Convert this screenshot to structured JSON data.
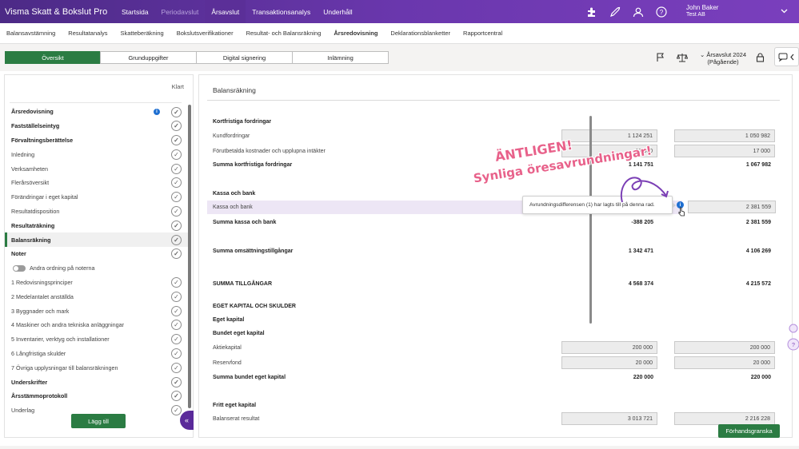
{
  "app": {
    "title": "Visma Skatt & Bokslut Pro",
    "top_nav": [
      "Startsida",
      "Periodavslut",
      "Årsavslut",
      "Transaktionsanalys",
      "Underhåll"
    ],
    "user_name": "John Baker",
    "user_company": "Test AB",
    "colors": {
      "brand": "#5b2f98",
      "accent": "#2b7c43",
      "info": "#1f6fd1",
      "promo": "#e8618a"
    }
  },
  "sub_nav": [
    "Balansavstämning",
    "Resultatanalys",
    "Skatteberäkning",
    "Bokslutsverifikationer",
    "Resultat- och Balansräkning",
    "Årsredovisning",
    "Deklarationsblanketter",
    "Rapportcentral"
  ],
  "tabs": [
    "Översikt",
    "Grunduppgifter",
    "Digital signering",
    "Inlämning"
  ],
  "year": {
    "line1": "Årsavslut 2024",
    "line2": "(Pågående)"
  },
  "left": {
    "klart": "Klart",
    "items": [
      {
        "label": "Årsredovisning",
        "bold": true,
        "check": true,
        "info": true
      },
      {
        "label": "Fastställelseintyg",
        "bold": true,
        "check": true
      },
      {
        "label": "Förvaltningsberättelse",
        "bold": true,
        "check": true
      },
      {
        "label": "Inledning",
        "bold": false,
        "check": true
      },
      {
        "label": "Verksamheten",
        "bold": false,
        "check": true
      },
      {
        "label": "Flerårsöversikt",
        "bold": false,
        "check": true
      },
      {
        "label": "Förändringar i eget kapital",
        "bold": false,
        "check": true
      },
      {
        "label": "Resultatdisposition",
        "bold": false,
        "check": true
      },
      {
        "label": "Resultaträkning",
        "bold": true,
        "check": true
      },
      {
        "label": "Balansräkning",
        "bold": true,
        "check": true,
        "selected": true
      },
      {
        "label": "Noter",
        "bold": true,
        "check": true
      },
      {
        "label": "Andra ordning på noterna",
        "bold": false,
        "check": false,
        "toggle": true
      },
      {
        "label": "1 Redovisningsprinciper",
        "bold": false,
        "check": true
      },
      {
        "label": "2 Medelantalet anställda",
        "bold": false,
        "check": true
      },
      {
        "label": "3 Byggnader och mark",
        "bold": false,
        "check": true
      },
      {
        "label": "4 Maskiner och andra tekniska anläggningar",
        "bold": false,
        "check": true
      },
      {
        "label": "5 Inventarier, verktyg och installationer",
        "bold": false,
        "check": true
      },
      {
        "label": "6 Långfristiga skulder",
        "bold": false,
        "check": true
      },
      {
        "label": "7 Övriga upplysningar till balansräkningen",
        "bold": false,
        "check": true
      },
      {
        "label": "Underskrifter",
        "bold": true,
        "check": true
      },
      {
        "label": "Årsstämmoprotokoll",
        "bold": true,
        "check": true
      },
      {
        "label": "Underlag",
        "bold": false,
        "check": true
      }
    ],
    "add_button": "Lägg till"
  },
  "main": {
    "title": "Balansräkning",
    "rows": [
      {
        "label": "Kortfristiga fordringar",
        "type": "heading"
      },
      {
        "label": "Kundfordringar",
        "type": "input",
        "a": "1 124 251",
        "b": "1 050 982"
      },
      {
        "label": "Förutbetalda kostnader och upplupna intäkter",
        "type": "input",
        "a": "17 500",
        "b": "17 000"
      },
      {
        "label": "Summa kortfristiga fordringar",
        "type": "sum",
        "a": "1 141 751",
        "b": "1 067 982"
      },
      {
        "label": "Kassa och bank",
        "type": "heading"
      },
      {
        "label": "Kassa och bank",
        "type": "highlight",
        "b": "2 381 559"
      },
      {
        "label": "Summa kassa och bank",
        "type": "sum",
        "a": "-388 205",
        "b": "2 381 559"
      },
      {
        "label": "Summa omsättningstillgångar",
        "type": "sum",
        "a": "1 342 471",
        "b": "4 106 269"
      },
      {
        "label": "SUMMA TILLGÅNGAR",
        "type": "sum",
        "a": "4 568 374",
        "b": "4 215 572"
      },
      {
        "label": "EGET KAPITAL OCH SKULDER",
        "type": "heading"
      },
      {
        "label": "Eget kapital",
        "type": "heading"
      },
      {
        "label": "Bundet eget kapital",
        "type": "heading"
      },
      {
        "label": "Aktiekapital",
        "type": "input",
        "a": "200 000",
        "b": "200 000"
      },
      {
        "label": "Reservfond",
        "type": "input",
        "a": "20 000",
        "b": "20 000"
      },
      {
        "label": "Summa bundet eget kapital",
        "type": "sum",
        "a": "220 000",
        "b": "220 000"
      },
      {
        "label": "Fritt eget kapital",
        "type": "heading"
      },
      {
        "label": "Balanserat resultat",
        "type": "input",
        "a": "3 013 721",
        "b": "2 216 228"
      }
    ],
    "tooltip": "Avrundningsdifferensen (1) har lagts till på denna rad.",
    "preview_button": "Förhandsgranska"
  },
  "promo": {
    "line1": "ÄNTLIGEN!",
    "line2": "Synliga öresavrundningar!"
  }
}
